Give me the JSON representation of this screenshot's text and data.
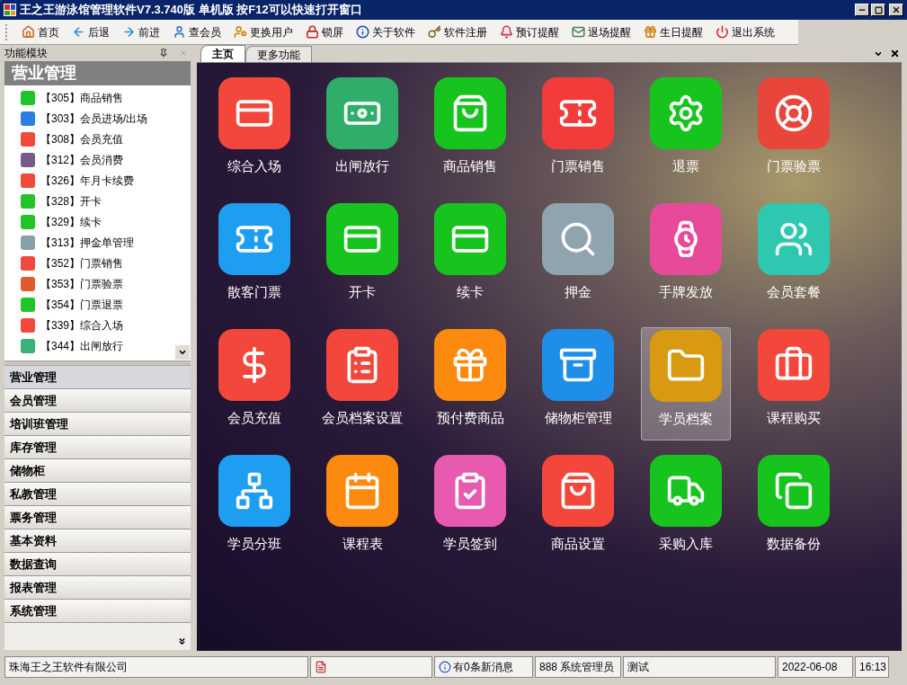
{
  "window": {
    "title": "王之王游泳馆管理软件V7.3.740版 单机版 按F12可以快速打开窗口"
  },
  "toolbar": [
    "首页",
    "后退",
    "前进",
    "查会员",
    "更换用户",
    "锁屏",
    "关于软件",
    "软件注册",
    "预订提醒",
    "退场提醒",
    "生日提醒",
    "退出系统"
  ],
  "sidebar": {
    "title": "功能模块",
    "section": "营业管理",
    "items": [
      {
        "label": "【305】商品销售",
        "color": "#22c32a"
      },
      {
        "label": "【303】会员进场/出场",
        "color": "#2a7fe0"
      },
      {
        "label": "【308】会员充值",
        "color": "#f04a3c"
      },
      {
        "label": "【312】会员消费",
        "color": "#7a5a8a"
      },
      {
        "label": "【326】年月卡续费",
        "color": "#f04a3c"
      },
      {
        "label": "【328】开卡",
        "color": "#22c32a"
      },
      {
        "label": "【329】续卡",
        "color": "#22c32a"
      },
      {
        "label": "【313】押金单管理",
        "color": "#8aa0a8"
      },
      {
        "label": "【352】门票销售",
        "color": "#f04a3c"
      },
      {
        "label": "【353】门票验票",
        "color": "#e05a30"
      },
      {
        "label": "【354】门票退票",
        "color": "#22c32a"
      },
      {
        "label": "【339】综合入场",
        "color": "#f04a3c"
      },
      {
        "label": "【344】出闸放行",
        "color": "#3ab07a"
      }
    ],
    "categories": [
      {
        "label": "营业管理",
        "selected": true
      },
      {
        "label": "会员管理",
        "selected": false
      },
      {
        "label": "培训班管理",
        "selected": false
      },
      {
        "label": "库存管理",
        "selected": false
      },
      {
        "label": "储物柜",
        "selected": false
      },
      {
        "label": "私教管理",
        "selected": false
      },
      {
        "label": "票务管理",
        "selected": false
      },
      {
        "label": "基本资料",
        "selected": false
      },
      {
        "label": "数据查询",
        "selected": false
      },
      {
        "label": "报表管理",
        "selected": false
      },
      {
        "label": "系统管理",
        "selected": false
      }
    ]
  },
  "tabs": [
    {
      "label": "主页",
      "selected": true
    },
    {
      "label": "更多功能",
      "selected": false
    }
  ],
  "tiles": [
    {
      "label": "综合入场",
      "color": "#f2473a",
      "selected": false
    },
    {
      "label": "出闸放行",
      "color": "#2fae6a",
      "selected": false
    },
    {
      "label": "商品销售",
      "color": "#17c41e",
      "selected": false
    },
    {
      "label": "门票销售",
      "color": "#f23c3c",
      "selected": false
    },
    {
      "label": "退票",
      "color": "#17c41e",
      "selected": false
    },
    {
      "label": "门票验票",
      "color": "#e8463a",
      "selected": false
    },
    {
      "label": "散客门票",
      "color": "#1e9ef0",
      "selected": false
    },
    {
      "label": "开卡",
      "color": "#17c41e",
      "selected": false
    },
    {
      "label": "续卡",
      "color": "#17c41e",
      "selected": false
    },
    {
      "label": "押金",
      "color": "#8fa4ae",
      "selected": false
    },
    {
      "label": "手牌发放",
      "color": "#e84a9a",
      "selected": false
    },
    {
      "label": "会员套餐",
      "color": "#2ec8b0",
      "selected": false
    },
    {
      "label": "会员充值",
      "color": "#f2473a",
      "selected": false
    },
    {
      "label": "会员档案设置",
      "color": "#f2473a",
      "selected": false
    },
    {
      "label": "预付费商品",
      "color": "#fb8a0e",
      "selected": false
    },
    {
      "label": "储物柜管理",
      "color": "#1e8ee8",
      "selected": false
    },
    {
      "label": "学员档案",
      "color": "#d89a10",
      "selected": true
    },
    {
      "label": "课程购买",
      "color": "#f2473a",
      "selected": false
    },
    {
      "label": "学员分班",
      "color": "#1e9ef0",
      "selected": false
    },
    {
      "label": "课程表",
      "color": "#fb8a0e",
      "selected": false
    },
    {
      "label": "学员签到",
      "color": "#e85ab0",
      "selected": false
    },
    {
      "label": "商品设置",
      "color": "#f2473a",
      "selected": false
    },
    {
      "label": "采购入库",
      "color": "#17c41e",
      "selected": false
    },
    {
      "label": "数据备份",
      "color": "#17c41e",
      "selected": false
    }
  ],
  "status_bar": {
    "company": "珠海王之王软件有限公司",
    "messages": "有0条新消息",
    "user": "888 系统管理员",
    "note": "测试",
    "date": "2022-06-08",
    "time": "16:13"
  }
}
